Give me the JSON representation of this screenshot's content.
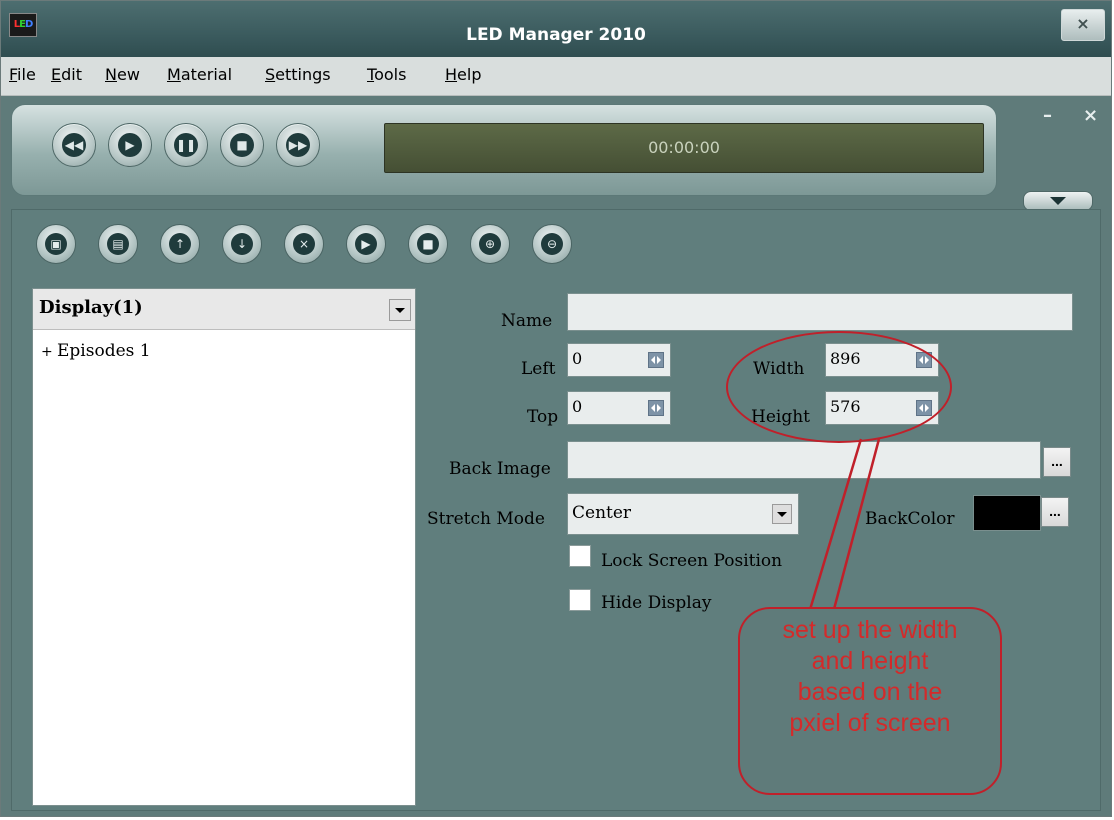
{
  "window": {
    "title": "LED Manager 2010",
    "logo_text": "LED",
    "close_glyph": "×"
  },
  "menu": [
    "File",
    "Edit",
    "New",
    "Material",
    "Settings",
    "Tools",
    "Help"
  ],
  "transport": {
    "buttons": [
      {
        "name": "rewind-button",
        "icon": "rewind-icon",
        "glyph": "◀◀"
      },
      {
        "name": "play-button",
        "icon": "play-icon",
        "glyph": "▶"
      },
      {
        "name": "pause-button",
        "icon": "pause-icon",
        "glyph": "❚❚"
      },
      {
        "name": "stop-button",
        "icon": "stop-icon",
        "glyph": "■"
      },
      {
        "name": "fast-forward-button",
        "icon": "fast-forward-icon",
        "glyph": "▶▶"
      }
    ],
    "time": "00:00:00"
  },
  "panel_controls": {
    "minimize": "–",
    "close": "×"
  },
  "toolbar": [
    {
      "name": "new-display-button",
      "icon": "new-display-icon",
      "glyph": "▣"
    },
    {
      "name": "new-program-button",
      "icon": "film-icon",
      "glyph": "▤"
    },
    {
      "name": "move-up-button",
      "icon": "arrow-up-icon",
      "glyph": "↑"
    },
    {
      "name": "move-down-button",
      "icon": "arrow-down-icon",
      "glyph": "↓"
    },
    {
      "name": "delete-button",
      "icon": "delete-icon",
      "glyph": "×"
    },
    {
      "name": "preview-play-button",
      "icon": "play-icon",
      "glyph": "▶"
    },
    {
      "name": "preview-stop-button",
      "icon": "stop-icon",
      "glyph": "■"
    },
    {
      "name": "zoom-in-button",
      "icon": "zoom-in-icon",
      "glyph": "⊕"
    },
    {
      "name": "zoom-out-button",
      "icon": "zoom-out-icon",
      "glyph": "⊖"
    }
  ],
  "tree": {
    "selector": "Display(1)",
    "items": [
      {
        "expander": "+",
        "label": "Episodes 1"
      }
    ]
  },
  "form": {
    "name_label": "Name",
    "name_value": "",
    "left_label": "Left",
    "left_value": "0",
    "top_label": "Top",
    "top_value": "0",
    "width_label": "Width",
    "width_value": "896",
    "height_label": "Height",
    "height_value": "576",
    "back_image_label": "Back Image",
    "back_image_value": "",
    "stretch_mode_label": "Stretch Mode",
    "stretch_mode_value": "Center",
    "backcolor_label": "BackColor",
    "backcolor_value": "#000000",
    "browse_glyph": "...",
    "lock_label": "Lock Screen Position",
    "lock_checked": false,
    "hide_label": "Hide Display",
    "hide_checked": false
  },
  "annotation": {
    "lines": [
      "set up the width",
      "and height",
      "based on the",
      "pxiel of screen"
    ],
    "color": "#c0202a"
  }
}
